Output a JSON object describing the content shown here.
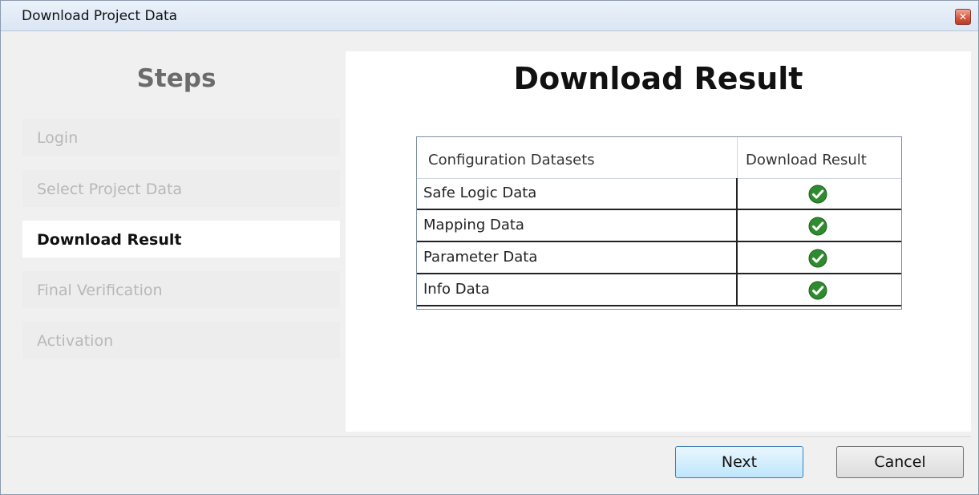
{
  "window": {
    "title": "Download Project Data",
    "close_glyph": "✕"
  },
  "sidebar": {
    "title": "Steps",
    "items": [
      {
        "label": "Login",
        "state": "disabled"
      },
      {
        "label": "Select Project Data",
        "state": "disabled"
      },
      {
        "label": "Download Result",
        "state": "active"
      },
      {
        "label": "Final Verification",
        "state": "disabled"
      },
      {
        "label": "Activation",
        "state": "disabled"
      }
    ]
  },
  "main": {
    "title": "Download Result",
    "table": {
      "columns": [
        "Configuration Datasets",
        "Download Result"
      ],
      "rows": [
        {
          "name": "Safe Logic Data",
          "result_icon": "success-check-icon"
        },
        {
          "name": "Mapping Data",
          "result_icon": "success-check-icon"
        },
        {
          "name": "Parameter Data",
          "result_icon": "success-check-icon"
        },
        {
          "name": "Info Data",
          "result_icon": "success-check-icon"
        }
      ]
    }
  },
  "footer": {
    "next_label": "Next",
    "cancel_label": "Cancel"
  },
  "colors": {
    "success": "#2e8b2e",
    "accent_border": "#3c7fb1"
  }
}
